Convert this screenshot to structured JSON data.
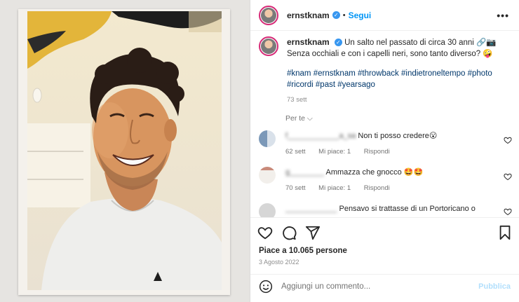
{
  "post": {
    "author": "ernstknam",
    "follow_label": "Segui",
    "more_label": "•••",
    "caption_text": "Un salto nel passato di circa 30 anni 🔗📷 Senza occhiali e con i capelli neri, sono tanto diverso? 🤪",
    "hashtags": "#knam #ernstknam #throwback #indietroneltempo #photo #ricordi #past #yearsago",
    "caption_time": "73 sett",
    "for_you_label": "Per te ⌵"
  },
  "comments": [
    {
      "user": "f____________a_sa",
      "text": "Non ti posso credere😮",
      "time": "62 sett",
      "likes": "Mi piace: 1",
      "reply": "Rispondi"
    },
    {
      "user": "g________",
      "text": "Ammazza che gnocco 🤩🤩",
      "time": "70 sett",
      "likes": "Mi piace: 1",
      "reply": "Rispondi"
    },
    {
      "user": "____________",
      "text": "Pensavo si trattasse di un Portoricano o",
      "time": "",
      "likes": "",
      "reply": ""
    }
  ],
  "actions": {
    "likes_text": "Piace a 10.065 persone",
    "date_text": "3 Agosto 2022",
    "comment_placeholder": "Aggiungi un commento...",
    "publish_label": "Pubblica"
  },
  "colors": {
    "accent": "#0095f6",
    "verified": "#3897f0",
    "link": "#00376b",
    "publish_disabled": "#b2dffc"
  },
  "icons": [
    "verified-badge-icon",
    "more-options-icon",
    "heart-icon",
    "comment-icon",
    "share-icon",
    "bookmark-icon",
    "emoji-icon",
    "chevron-down-icon"
  ]
}
